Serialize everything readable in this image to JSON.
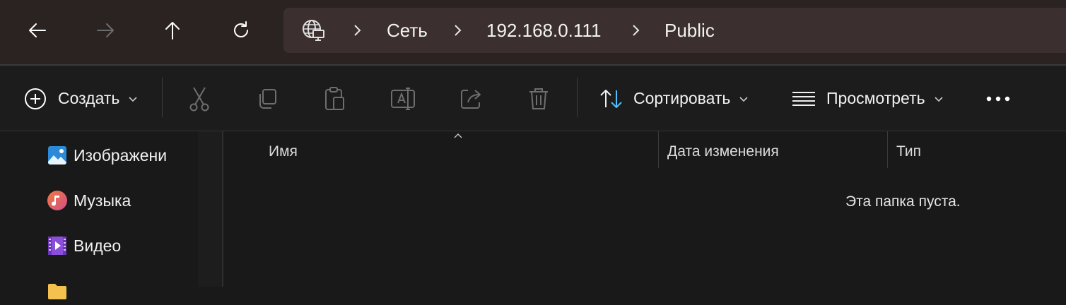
{
  "navigation": {
    "back_icon": "arrow-left-icon",
    "forward_icon": "arrow-right-icon",
    "up_icon": "arrow-up-icon",
    "refresh_icon": "refresh-icon"
  },
  "address_bar": {
    "location_icon": "network-globe-icon",
    "breadcrumbs": [
      "Сеть",
      "192.168.0.111",
      "Public"
    ]
  },
  "toolbar": {
    "new_label": "Создать",
    "cut_icon": "scissors-icon",
    "copy_icon": "copy-icon",
    "paste_icon": "paste-icon",
    "rename_icon": "rename-icon",
    "share_icon": "share-icon",
    "delete_icon": "trash-icon",
    "sort_label": "Сортировать",
    "view_label": "Просмотреть",
    "more_icon": "more-icon"
  },
  "sidebar": {
    "items": [
      {
        "label": "Изображени",
        "icon": "pictures-icon",
        "pinned": true
      },
      {
        "label": "Музыка",
        "icon": "music-icon",
        "pinned": true
      },
      {
        "label": "Видео",
        "icon": "video-icon",
        "pinned": true
      }
    ]
  },
  "file_list": {
    "columns": [
      "Имя",
      "Дата изменения",
      "Тип"
    ],
    "sorted_column": "Имя",
    "empty_message": "Эта папка пуста."
  },
  "colors": {
    "titlebar": "#2b2222",
    "address_bar": "#3b2f2f",
    "background": "#191919",
    "accent": "#4cc2ff"
  }
}
